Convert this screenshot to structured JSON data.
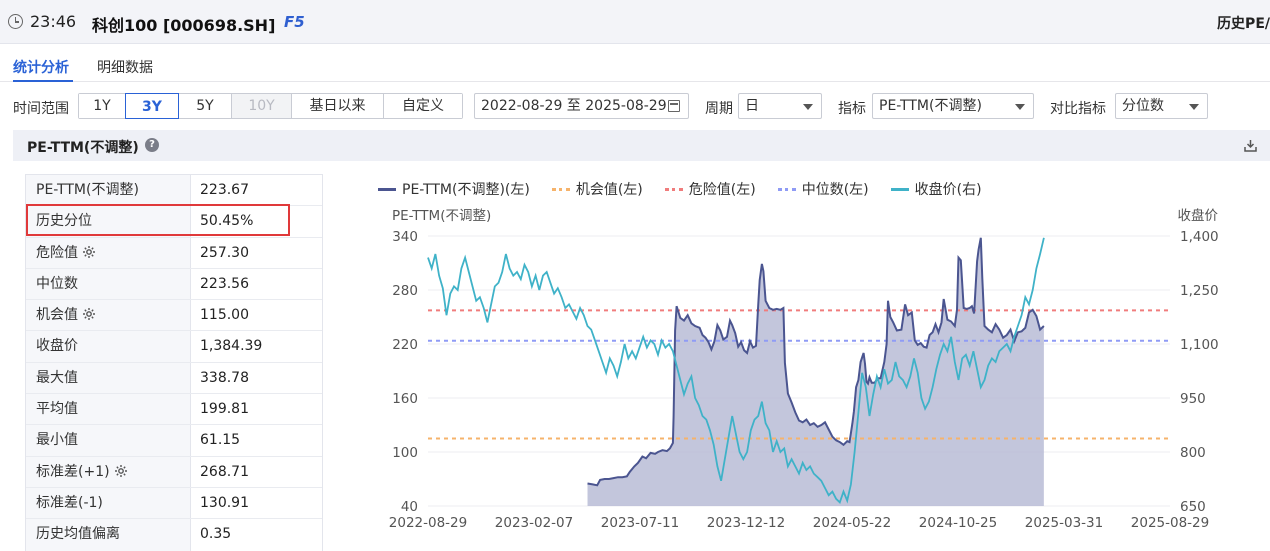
{
  "titlebar": {
    "time": "23:46",
    "security": "科创100 [000698.SH]",
    "fkey": "F5",
    "right_title": "历史PE/"
  },
  "tabs": [
    {
      "label": "统计分析",
      "active": true
    },
    {
      "label": "明细数据",
      "active": false
    }
  ],
  "filters": {
    "time_range_label": "时间范围",
    "ranges": [
      {
        "label": "1Y",
        "state": "normal"
      },
      {
        "label": "3Y",
        "state": "active"
      },
      {
        "label": "5Y",
        "state": "normal"
      },
      {
        "label": "10Y",
        "state": "disabled"
      },
      {
        "label": "基日以来",
        "state": "normal"
      },
      {
        "label": "自定义",
        "state": "normal"
      }
    ],
    "date_range": "2022-08-29 至 2025-08-29",
    "period_label": "周期",
    "period_value": "日",
    "indicator_label": "指标",
    "indicator_value": "PE-TTM(不调整)",
    "compare_label": "对比指标",
    "compare_value": "分位数"
  },
  "section": {
    "title": "PE-TTM(不调整)",
    "help_glyph": "?"
  },
  "stats": [
    {
      "label": "PE-TTM(不调整)",
      "value": "223.67",
      "gear": false
    },
    {
      "label": "历史分位",
      "value": "50.45%",
      "gear": false
    },
    {
      "label": "危险值",
      "value": "257.30",
      "gear": true
    },
    {
      "label": "中位数",
      "value": "223.56",
      "gear": false
    },
    {
      "label": "机会值",
      "value": "115.00",
      "gear": true
    },
    {
      "label": "收盘价",
      "value": "1,384.39",
      "gear": false
    },
    {
      "label": "最大值",
      "value": "338.78",
      "gear": false
    },
    {
      "label": "平均值",
      "value": "199.81",
      "gear": false
    },
    {
      "label": "最小值",
      "value": "61.15",
      "gear": false
    },
    {
      "label": "标准差(+1)",
      "value": "268.71",
      "gear": true
    },
    {
      "label": "标准差(-1)",
      "value": "130.91",
      "gear": false
    },
    {
      "label": "历史均值偏离",
      "value": "0.35",
      "gear": false
    }
  ],
  "colors": {
    "pe_line": "#4b5590",
    "pe_fill": "#b9bcd6",
    "opportunity": "#f6b36b",
    "danger": "#f07c7c",
    "median": "#8f9bf5",
    "price": "#3fb2c8",
    "highlight": "#e0393a",
    "accent": "#2a62d6"
  },
  "chart_data": {
    "type": "line",
    "legend": [
      {
        "name": "PE-TTM(不调整)(左)",
        "style": "solid",
        "color": "#4b5590"
      },
      {
        "name": "机会值(左)",
        "style": "dotted",
        "color": "#f6b36b"
      },
      {
        "name": "危险值(左)",
        "style": "dotted",
        "color": "#f07c7c"
      },
      {
        "name": "中位数(左)",
        "style": "dotted",
        "color": "#8f9bf5"
      },
      {
        "name": "收盘价(右)",
        "style": "solid",
        "color": "#3fb2c8"
      }
    ],
    "left_axis_title": "PE-TTM(不调整)",
    "right_axis_title": "收盘价",
    "left_ticks": [
      340,
      280,
      220,
      160,
      100,
      40
    ],
    "right_ticks": [
      "1,400",
      "1,250",
      "1,100",
      "950",
      "800",
      "650"
    ],
    "ylim_left": [
      40,
      340
    ],
    "ylim_right": [
      650,
      1400
    ],
    "x_ticks": [
      "2022-08-29",
      "2023-02-07",
      "2023-07-11",
      "2023-12-12",
      "2024-05-22",
      "2024-10-25",
      "2025-03-31",
      "2025-08-29"
    ],
    "reference_lines": {
      "danger": 257.3,
      "median": 223.56,
      "opportunity": 115.0
    },
    "pe_series": [
      [
        0.215,
        65
      ],
      [
        0.222,
        64
      ],
      [
        0.228,
        63
      ],
      [
        0.232,
        69
      ],
      [
        0.238,
        70
      ],
      [
        0.244,
        70
      ],
      [
        0.25,
        71
      ],
      [
        0.256,
        72
      ],
      [
        0.262,
        72
      ],
      [
        0.268,
        73
      ],
      [
        0.272,
        78
      ],
      [
        0.278,
        84
      ],
      [
        0.283,
        88
      ],
      [
        0.289,
        95
      ],
      [
        0.294,
        93
      ],
      [
        0.3,
        99
      ],
      [
        0.306,
        98
      ],
      [
        0.31,
        100
      ],
      [
        0.316,
        102
      ],
      [
        0.322,
        101
      ],
      [
        0.326,
        104
      ],
      [
        0.33,
        110
      ],
      [
        0.331,
        140
      ],
      [
        0.333,
        235
      ],
      [
        0.335,
        262
      ],
      [
        0.34,
        249
      ],
      [
        0.345,
        246
      ],
      [
        0.35,
        252
      ],
      [
        0.355,
        243
      ],
      [
        0.36,
        240
      ],
      [
        0.366,
        238
      ],
      [
        0.37,
        230
      ],
      [
        0.374,
        227
      ],
      [
        0.378,
        222
      ],
      [
        0.382,
        214
      ],
      [
        0.386,
        223
      ],
      [
        0.39,
        241
      ],
      [
        0.394,
        235
      ],
      [
        0.398,
        225
      ],
      [
        0.403,
        228
      ],
      [
        0.407,
        246
      ],
      [
        0.41,
        241
      ],
      [
        0.414,
        232
      ],
      [
        0.418,
        217
      ],
      [
        0.422,
        222
      ],
      [
        0.426,
        213
      ],
      [
        0.43,
        210
      ],
      [
        0.434,
        223
      ],
      [
        0.438,
        216
      ],
      [
        0.442,
        218
      ],
      [
        0.445,
        263
      ],
      [
        0.447,
        291
      ],
      [
        0.45,
        309
      ],
      [
        0.452,
        301
      ],
      [
        0.455,
        268
      ],
      [
        0.46,
        260
      ],
      [
        0.465,
        258
      ],
      [
        0.47,
        259
      ],
      [
        0.475,
        258
      ],
      [
        0.479,
        260
      ],
      [
        0.481,
        199
      ],
      [
        0.485,
        165
      ],
      [
        0.49,
        155
      ],
      [
        0.495,
        144
      ],
      [
        0.5,
        135
      ],
      [
        0.505,
        133
      ],
      [
        0.51,
        136
      ],
      [
        0.515,
        130
      ],
      [
        0.52,
        132
      ],
      [
        0.525,
        128
      ],
      [
        0.53,
        130
      ],
      [
        0.535,
        133
      ],
      [
        0.54,
        125
      ],
      [
        0.545,
        117
      ],
      [
        0.55,
        113
      ],
      [
        0.555,
        111
      ],
      [
        0.56,
        108
      ],
      [
        0.565,
        112
      ],
      [
        0.568,
        111
      ],
      [
        0.57,
        121
      ],
      [
        0.572,
        132
      ],
      [
        0.574,
        145
      ],
      [
        0.577,
        172
      ],
      [
        0.58,
        180
      ],
      [
        0.583,
        200
      ],
      [
        0.585,
        205
      ],
      [
        0.587,
        210
      ],
      [
        0.589,
        198
      ],
      [
        0.591,
        178
      ],
      [
        0.593,
        176
      ],
      [
        0.595,
        183
      ],
      [
        0.598,
        177
      ],
      [
        0.602,
        177
      ],
      [
        0.606,
        182
      ],
      [
        0.61,
        182
      ],
      [
        0.615,
        200
      ],
      [
        0.618,
        220
      ],
      [
        0.62,
        268
      ],
      [
        0.623,
        250
      ],
      [
        0.627,
        244
      ],
      [
        0.632,
        235
      ],
      [
        0.638,
        236
      ],
      [
        0.643,
        264
      ],
      [
        0.647,
        252
      ],
      [
        0.652,
        255
      ],
      [
        0.656,
        224
      ],
      [
        0.66,
        219
      ],
      [
        0.664,
        221
      ],
      [
        0.668,
        217
      ],
      [
        0.672,
        216
      ],
      [
        0.676,
        230
      ],
      [
        0.68,
        233
      ],
      [
        0.684,
        242
      ],
      [
        0.688,
        233
      ],
      [
        0.692,
        244
      ],
      [
        0.695,
        270
      ],
      [
        0.7,
        247
      ],
      [
        0.705,
        245
      ],
      [
        0.71,
        240
      ],
      [
        0.713,
        258
      ],
      [
        0.715,
        316
      ],
      [
        0.718,
        313
      ],
      [
        0.722,
        260
      ],
      [
        0.726,
        259
      ],
      [
        0.73,
        260
      ],
      [
        0.733,
        262
      ],
      [
        0.736,
        254
      ],
      [
        0.74,
        312
      ],
      [
        0.742,
        325
      ],
      [
        0.745,
        338
      ],
      [
        0.747,
        293
      ],
      [
        0.75,
        240
      ],
      [
        0.755,
        236
      ],
      [
        0.76,
        233
      ],
      [
        0.765,
        242
      ],
      [
        0.77,
        236
      ],
      [
        0.775,
        227
      ],
      [
        0.78,
        230
      ],
      [
        0.785,
        236
      ],
      [
        0.79,
        223
      ],
      [
        0.795,
        233
      ],
      [
        0.8,
        234
      ],
      [
        0.805,
        238
      ],
      [
        0.81,
        255
      ],
      [
        0.815,
        258
      ],
      [
        0.82,
        251
      ],
      [
        0.825,
        236
      ],
      [
        0.83,
        240
      ]
    ],
    "price_series": [
      [
        0.0,
        1340
      ],
      [
        0.005,
        1310
      ],
      [
        0.01,
        1350
      ],
      [
        0.015,
        1290
      ],
      [
        0.02,
        1255
      ],
      [
        0.025,
        1180
      ],
      [
        0.03,
        1240
      ],
      [
        0.035,
        1260
      ],
      [
        0.04,
        1250
      ],
      [
        0.045,
        1310
      ],
      [
        0.05,
        1340
      ],
      [
        0.055,
        1300
      ],
      [
        0.06,
        1260
      ],
      [
        0.065,
        1220
      ],
      [
        0.07,
        1230
      ],
      [
        0.075,
        1200
      ],
      [
        0.08,
        1160
      ],
      [
        0.085,
        1210
      ],
      [
        0.09,
        1260
      ],
      [
        0.095,
        1270
      ],
      [
        0.1,
        1300
      ],
      [
        0.105,
        1350
      ],
      [
        0.11,
        1310
      ],
      [
        0.115,
        1290
      ],
      [
        0.12,
        1300
      ],
      [
        0.125,
        1280
      ],
      [
        0.13,
        1320
      ],
      [
        0.135,
        1300
      ],
      [
        0.14,
        1260
      ],
      [
        0.145,
        1290
      ],
      [
        0.15,
        1250
      ],
      [
        0.155,
        1290
      ],
      [
        0.16,
        1300
      ],
      [
        0.165,
        1270
      ],
      [
        0.17,
        1240
      ],
      [
        0.175,
        1255
      ],
      [
        0.18,
        1230
      ],
      [
        0.185,
        1200
      ],
      [
        0.19,
        1210
      ],
      [
        0.195,
        1190
      ],
      [
        0.2,
        1170
      ],
      [
        0.205,
        1200
      ],
      [
        0.21,
        1180
      ],
      [
        0.215,
        1150
      ],
      [
        0.22,
        1140
      ],
      [
        0.225,
        1110
      ],
      [
        0.23,
        1080
      ],
      [
        0.235,
        1050
      ],
      [
        0.24,
        1020
      ],
      [
        0.245,
        1060
      ],
      [
        0.25,
        1040
      ],
      [
        0.255,
        1010
      ],
      [
        0.26,
        1050
      ],
      [
        0.265,
        1100
      ],
      [
        0.27,
        1060
      ],
      [
        0.275,
        1080
      ],
      [
        0.28,
        1060
      ],
      [
        0.285,
        1090
      ],
      [
        0.29,
        1120
      ],
      [
        0.295,
        1090
      ],
      [
        0.3,
        1110
      ],
      [
        0.305,
        1100
      ],
      [
        0.31,
        1070
      ],
      [
        0.315,
        1110
      ],
      [
        0.32,
        1090
      ],
      [
        0.325,
        1100
      ],
      [
        0.33,
        1080
      ],
      [
        0.335,
        1040
      ],
      [
        0.34,
        1000
      ],
      [
        0.345,
        960
      ],
      [
        0.35,
        990
      ],
      [
        0.355,
        1010
      ],
      [
        0.36,
        950
      ],
      [
        0.365,
        930
      ],
      [
        0.37,
        900
      ],
      [
        0.375,
        890
      ],
      [
        0.38,
        860
      ],
      [
        0.385,
        820
      ],
      [
        0.39,
        760
      ],
      [
        0.395,
        720
      ],
      [
        0.4,
        780
      ],
      [
        0.405,
        840
      ],
      [
        0.41,
        900
      ],
      [
        0.415,
        850
      ],
      [
        0.42,
        800
      ],
      [
        0.425,
        780
      ],
      [
        0.43,
        800
      ],
      [
        0.435,
        860
      ],
      [
        0.44,
        890
      ],
      [
        0.445,
        900
      ],
      [
        0.45,
        940
      ],
      [
        0.455,
        880
      ],
      [
        0.46,
        860
      ],
      [
        0.465,
        800
      ],
      [
        0.47,
        830
      ],
      [
        0.475,
        800
      ],
      [
        0.48,
        810
      ],
      [
        0.485,
        760
      ],
      [
        0.49,
        780
      ],
      [
        0.495,
        760
      ],
      [
        0.5,
        740
      ],
      [
        0.505,
        770
      ],
      [
        0.51,
        750
      ],
      [
        0.515,
        760
      ],
      [
        0.52,
        740
      ],
      [
        0.525,
        730
      ],
      [
        0.53,
        720
      ],
      [
        0.535,
        700
      ],
      [
        0.54,
        680
      ],
      [
        0.545,
        690
      ],
      [
        0.55,
        670
      ],
      [
        0.555,
        660
      ],
      [
        0.56,
        690
      ],
      [
        0.565,
        665
      ],
      [
        0.57,
        710
      ],
      [
        0.575,
        800
      ],
      [
        0.58,
        910
      ],
      [
        0.585,
        1020
      ],
      [
        0.59,
        980
      ],
      [
        0.595,
        900
      ],
      [
        0.6,
        960
      ],
      [
        0.605,
        1010
      ],
      [
        0.61,
        980
      ],
      [
        0.615,
        1030
      ],
      [
        0.62,
        990
      ],
      [
        0.625,
        1000
      ],
      [
        0.63,
        1050
      ],
      [
        0.635,
        1010
      ],
      [
        0.64,
        1000
      ],
      [
        0.645,
        980
      ],
      [
        0.65,
        1010
      ],
      [
        0.655,
        1060
      ],
      [
        0.66,
        1020
      ],
      [
        0.665,
        950
      ],
      [
        0.67,
        920
      ],
      [
        0.675,
        940
      ],
      [
        0.68,
        980
      ],
      [
        0.685,
        1030
      ],
      [
        0.69,
        1070
      ],
      [
        0.695,
        1100
      ],
      [
        0.7,
        1080
      ],
      [
        0.705,
        1120
      ],
      [
        0.71,
        1050
      ],
      [
        0.715,
        1000
      ],
      [
        0.72,
        1060
      ],
      [
        0.725,
        1070
      ],
      [
        0.73,
        1040
      ],
      [
        0.735,
        1080
      ],
      [
        0.74,
        1030
      ],
      [
        0.745,
        980
      ],
      [
        0.75,
        1000
      ],
      [
        0.755,
        1040
      ],
      [
        0.76,
        1060
      ],
      [
        0.765,
        1050
      ],
      [
        0.77,
        1080
      ],
      [
        0.775,
        1090
      ],
      [
        0.78,
        1100
      ],
      [
        0.785,
        1080
      ],
      [
        0.79,
        1120
      ],
      [
        0.795,
        1150
      ],
      [
        0.8,
        1180
      ],
      [
        0.805,
        1230
      ],
      [
        0.81,
        1210
      ],
      [
        0.815,
        1250
      ],
      [
        0.82,
        1310
      ],
      [
        0.825,
        1350
      ],
      [
        0.83,
        1395
      ]
    ]
  }
}
